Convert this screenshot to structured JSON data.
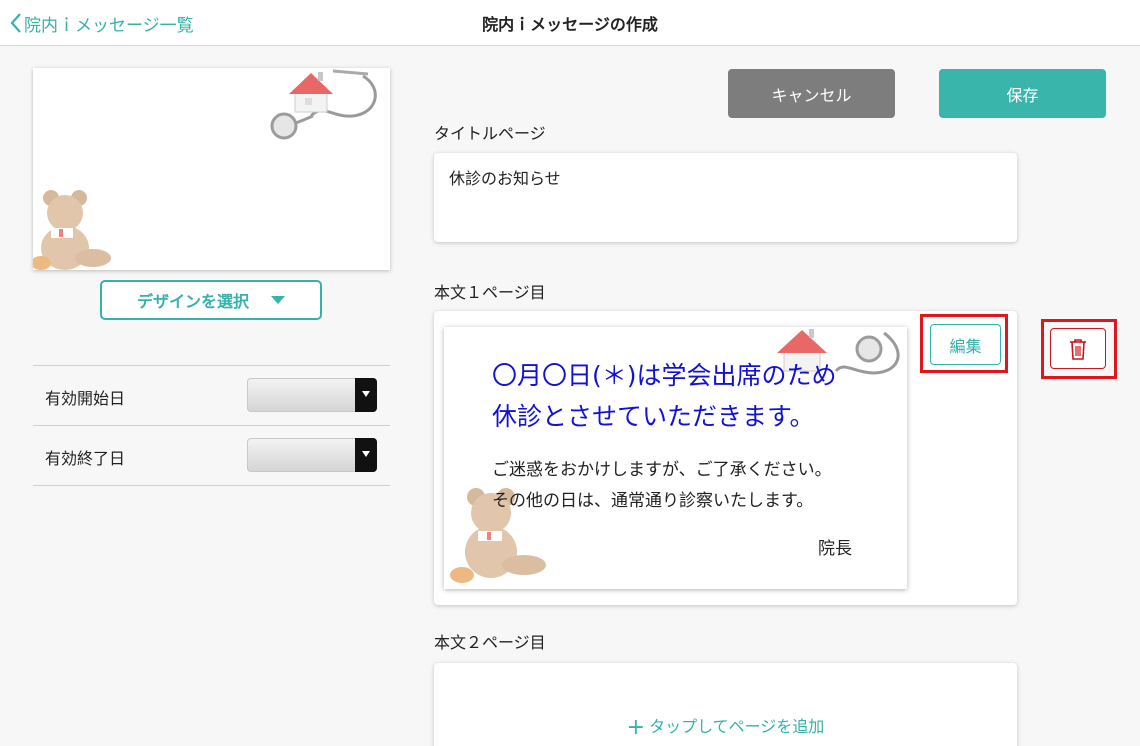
{
  "nav": {
    "back_label": "院内ｉメッセージ一覧",
    "title": "院内ｉメッセージの作成"
  },
  "left": {
    "design_button": "デザインを選択",
    "start_date_label": "有効開始日",
    "end_date_label": "有効終了日"
  },
  "actions": {
    "cancel": "キャンセル",
    "save": "保存"
  },
  "title_page": {
    "label": "タイトルページ",
    "value": "休診のお知らせ"
  },
  "page1": {
    "label": "本文１ページ目",
    "headline_1": "〇月〇日(＊)は学会出席のため",
    "headline_2": "休診とさせていただきます。",
    "body_1": "ご迷惑をおかけしますが、ご了承ください。",
    "body_2": "その他の日は、通常通り診察いたします。",
    "signature": "院長",
    "edit_button": "編集"
  },
  "page2": {
    "label": "本文２ページ目",
    "add_button": "タップしてページを追加"
  },
  "colors": {
    "accent": "#35b2aa",
    "cancel": "#7d7d7d",
    "headline": "#1212d6",
    "highlight": "#e0161c"
  },
  "icons": [
    "chevron-left-icon",
    "caret-down-icon",
    "trash-icon",
    "plus-icon",
    "house-icon",
    "stethoscope-icon",
    "teddy-bear-icon"
  ]
}
